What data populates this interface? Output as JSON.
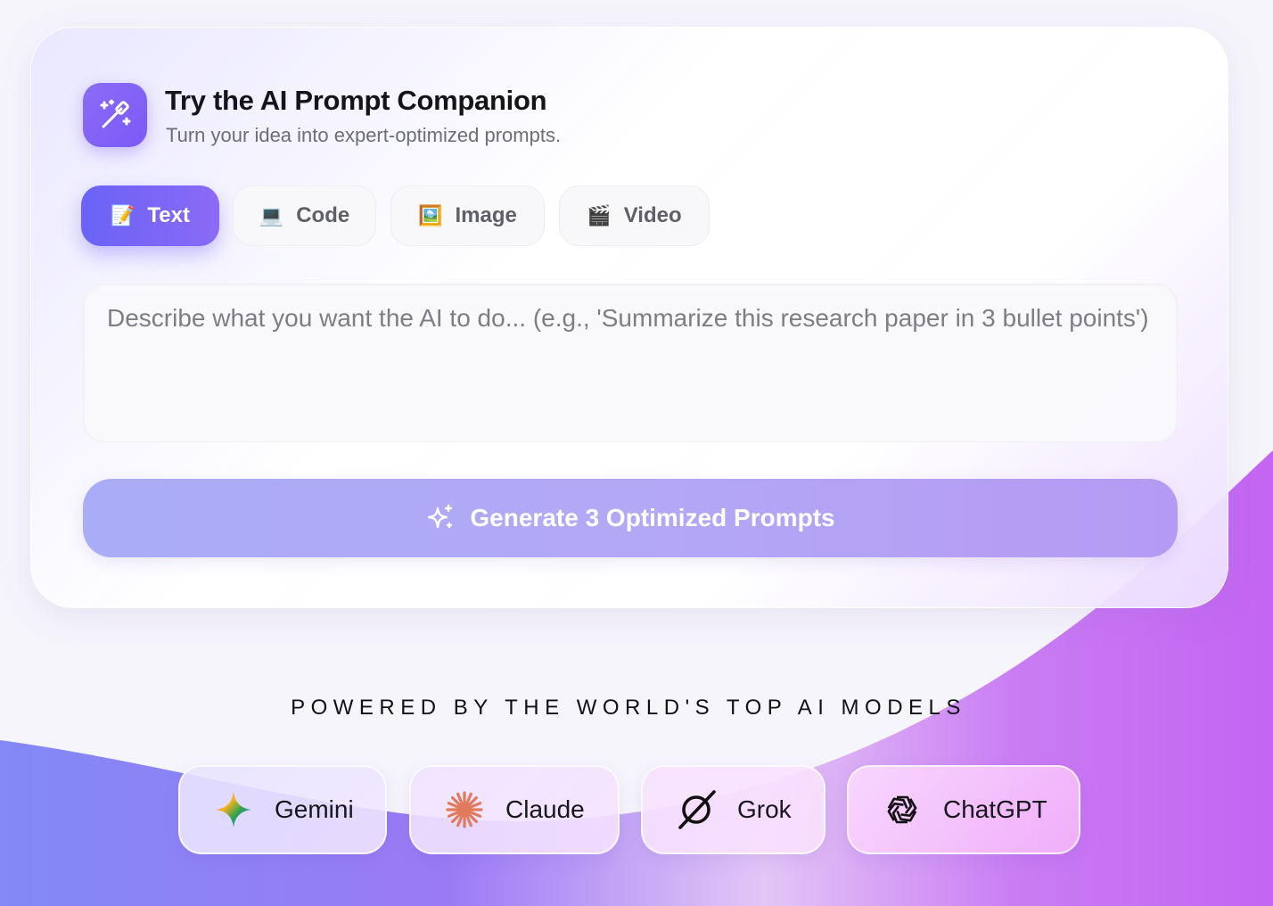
{
  "header": {
    "title": "Try the AI Prompt Companion",
    "subtitle": "Turn your idea into expert-optimized prompts.",
    "logo_icon": "magic-wand-icon"
  },
  "tabs": [
    {
      "label": "Text",
      "emoji": "📝",
      "active": true
    },
    {
      "label": "Code",
      "emoji": "💻",
      "active": false
    },
    {
      "label": "Image",
      "emoji": "🖼️",
      "active": false
    },
    {
      "label": "Video",
      "emoji": "🎬",
      "active": false
    }
  ],
  "prompt": {
    "placeholder": "Describe what you want the AI to do... (e.g., 'Summarize this research paper in 3 bullet points')",
    "value": ""
  },
  "generate_button": {
    "label": "Generate 3 Optimized Prompts",
    "icon": "sparkles-icon"
  },
  "powered_by": "POWERED BY THE WORLD'S TOP AI MODELS",
  "models": [
    {
      "label": "Gemini",
      "icon": "gemini-icon"
    },
    {
      "label": "Claude",
      "icon": "claude-icon"
    },
    {
      "label": "Grok",
      "icon": "grok-icon"
    },
    {
      "label": "ChatGPT",
      "icon": "chatgpt-icon"
    }
  ],
  "colors": {
    "accent": "#7a5af5",
    "tab_active_start": "#6a63f6",
    "tab_active_end": "#8b6af7",
    "button_start": "#a9acf6",
    "button_end": "#b59af3",
    "background_purple": "#c467f2"
  }
}
